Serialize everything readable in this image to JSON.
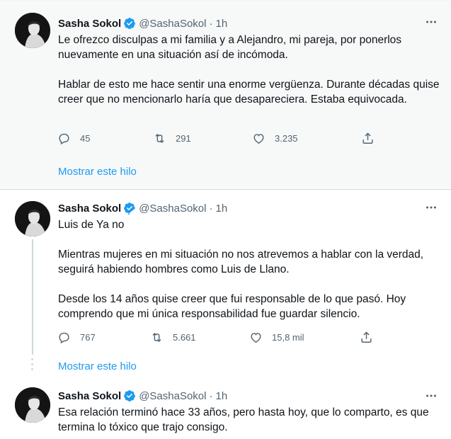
{
  "author": {
    "name": "Sasha Sokol",
    "handle": "@SashaSokol",
    "separator": "·",
    "time": "1h"
  },
  "tweets": [
    {
      "paragraphs": [
        "Le ofrezco disculpas a mi familia y a Alejandro, mi pareja, por ponerlos nuevamente en una situación así de incómoda.",
        "Hablar de esto me hace sentir una enorme vergüenza. Durante décadas quise creer que no mencionarlo haría que desapareciera. Estaba equivocada."
      ],
      "replies": "45",
      "retweets": "291",
      "likes": "3.235",
      "show_thread": "Mostrar este hilo"
    },
    {
      "paragraphs": [
        "Luis de Ya no",
        "Mientras mujeres en mi situación no nos atrevemos a hablar con la verdad, seguirá habiendo hombres como Luis de Llano.",
        "Desde los 14 años quise creer que fui responsable de lo que pasó. Hoy comprendo que mi única responsabilidad fue guardar silencio."
      ],
      "replies": "767",
      "retweets": "5.661",
      "likes": "15,8 mil",
      "show_thread": "Mostrar este hilo"
    },
    {
      "paragraphs": [
        "Esa relación terminó hace 33 años, pero hasta hoy, que lo comparto, es que termina lo tóxico que trajo consigo."
      ]
    }
  ],
  "icons": {
    "verified": "verified-badge-icon",
    "more": "more-options-icon",
    "reply": "reply-icon",
    "retweet": "retweet-icon",
    "like": "heart-icon",
    "share": "share-icon"
  },
  "colors": {
    "accent": "#1d9bf0",
    "secondary_text": "#536471",
    "highlight_bg": "#f7f9f9"
  }
}
